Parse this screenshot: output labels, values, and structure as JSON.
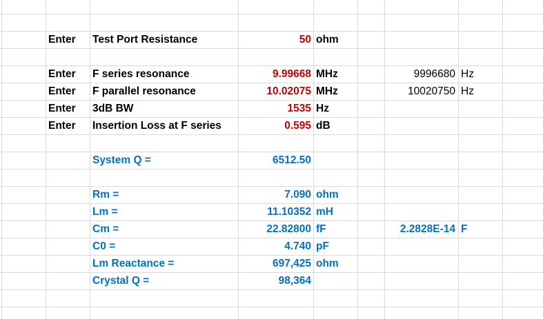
{
  "inputs": [
    {
      "prefix": "Enter",
      "label": "Test Port Resistance",
      "value": "50",
      "unit": "ohm"
    },
    {
      "prefix": "Enter",
      "label": "F series  resonance",
      "value": "9.99668",
      "unit": "MHz",
      "alt_value": "9996680",
      "alt_unit": "Hz"
    },
    {
      "prefix": "Enter",
      "label": "F parallel resonance",
      "value": "10.02075",
      "unit": "MHz",
      "alt_value": "10020750",
      "alt_unit": "Hz"
    },
    {
      "prefix": "Enter",
      "label": "3dB BW",
      "value": "1535",
      "unit": "Hz"
    },
    {
      "prefix": "Enter",
      "label": "Insertion Loss at F series",
      "value": "0.595",
      "unit": "dB"
    }
  ],
  "system_q": {
    "label": "System Q =",
    "value": "6512.50"
  },
  "results": [
    {
      "label": "Rm =",
      "value": "7.090",
      "unit": "ohm"
    },
    {
      "label": "Lm =",
      "value": "11.10352",
      "unit": "mH"
    },
    {
      "label": "Cm =",
      "value": "22.82800",
      "unit": "fF",
      "alt_value": "2.2828E-14",
      "alt_unit": "F"
    },
    {
      "label": "C0 =",
      "value": "4.740",
      "unit": "pF"
    },
    {
      "label": "Lm Reactance =",
      "value": "697,425",
      "unit": "ohm"
    },
    {
      "label": "Crystal Q =",
      "value": "98,364"
    }
  ],
  "colors": {
    "input": "#c00000",
    "output": "#0070c0",
    "grid": "#dadada"
  }
}
